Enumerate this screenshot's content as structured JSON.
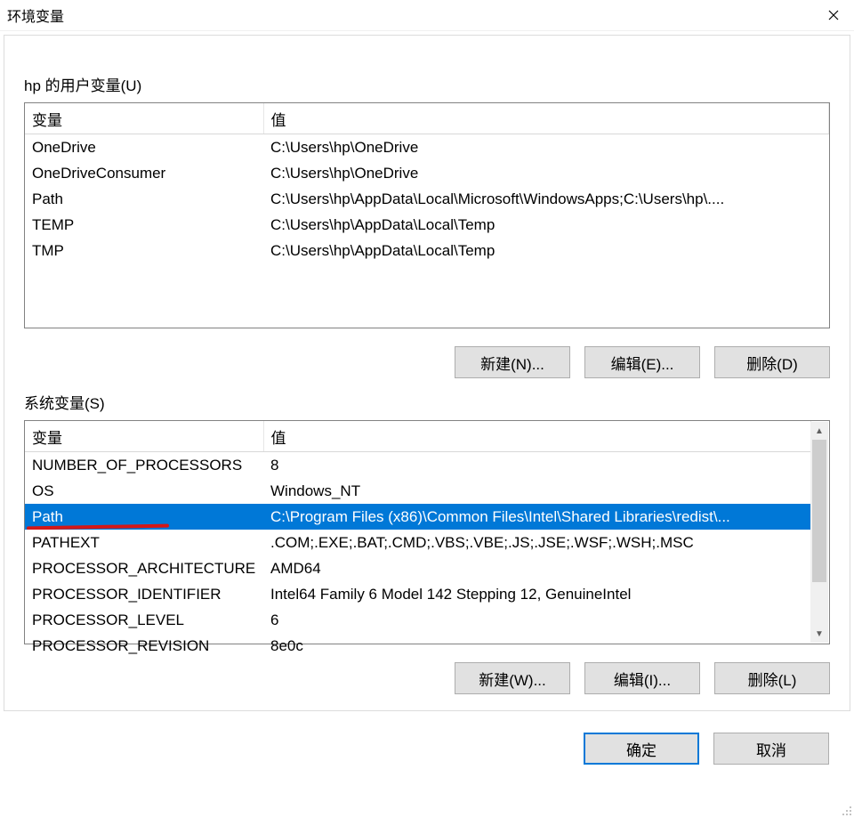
{
  "window": {
    "title": "环境变量"
  },
  "user_section": {
    "label": "hp 的用户变量(U)",
    "columns": {
      "var": "变量",
      "val": "值"
    },
    "rows": [
      {
        "var": "OneDrive",
        "val": "C:\\Users\\hp\\OneDrive"
      },
      {
        "var": "OneDriveConsumer",
        "val": "C:\\Users\\hp\\OneDrive"
      },
      {
        "var": "Path",
        "val": "C:\\Users\\hp\\AppData\\Local\\Microsoft\\WindowsApps;C:\\Users\\hp\\...."
      },
      {
        "var": "TEMP",
        "val": "C:\\Users\\hp\\AppData\\Local\\Temp"
      },
      {
        "var": "TMP",
        "val": "C:\\Users\\hp\\AppData\\Local\\Temp"
      }
    ],
    "buttons": {
      "new": "新建(N)...",
      "edit": "编辑(E)...",
      "delete": "删除(D)"
    }
  },
  "sys_section": {
    "label": "系统变量(S)",
    "columns": {
      "var": "变量",
      "val": "值"
    },
    "rows": [
      {
        "var": "NUMBER_OF_PROCESSORS",
        "val": "8"
      },
      {
        "var": "OS",
        "val": "Windows_NT"
      },
      {
        "var": "Path",
        "val": "C:\\Program Files (x86)\\Common Files\\Intel\\Shared Libraries\\redist\\..."
      },
      {
        "var": "PATHEXT",
        "val": ".COM;.EXE;.BAT;.CMD;.VBS;.VBE;.JS;.JSE;.WSF;.WSH;.MSC"
      },
      {
        "var": "PROCESSOR_ARCHITECTURE",
        "val": "AMD64"
      },
      {
        "var": "PROCESSOR_IDENTIFIER",
        "val": "Intel64 Family 6 Model 142 Stepping 12, GenuineIntel"
      },
      {
        "var": "PROCESSOR_LEVEL",
        "val": "6"
      },
      {
        "var": "PROCESSOR_REVISION",
        "val": "8e0c"
      }
    ],
    "selected_index": 2,
    "buttons": {
      "new": "新建(W)...",
      "edit": "编辑(I)...",
      "delete": "删除(L)"
    }
  },
  "bottom": {
    "ok": "确定",
    "cancel": "取消"
  }
}
